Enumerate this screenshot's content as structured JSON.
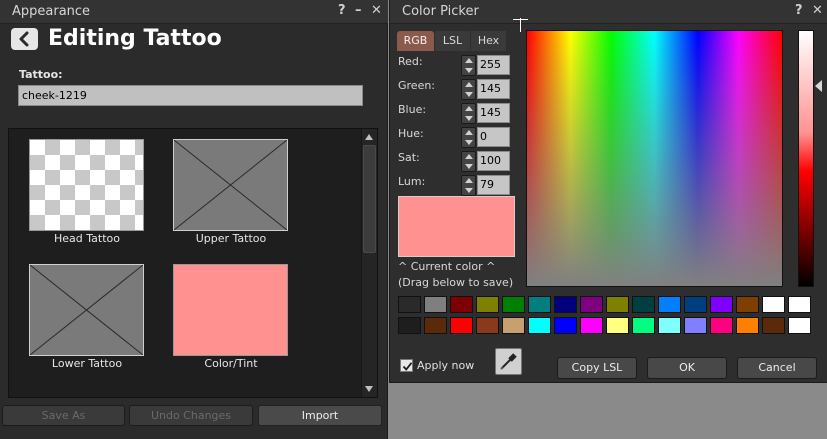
{
  "appearance": {
    "window_title": "Appearance",
    "help_label": "?",
    "minimize_label": "–",
    "close_label": "✕",
    "heading": "Editing Tattoo",
    "tattoo_label": "Tattoo:",
    "tattoo_value": "cheek-1219",
    "swatches": [
      {
        "label": "Head Tattoo"
      },
      {
        "label": "Upper Tattoo"
      },
      {
        "label": "Lower Tattoo"
      },
      {
        "label": "Color/Tint"
      }
    ],
    "buttons": {
      "save_as": "Save As",
      "undo_changes": "Undo Changes",
      "import": "Import"
    }
  },
  "color_picker": {
    "window_title": "Color Picker",
    "help_label": "?",
    "close_label": "✕",
    "tabs": [
      {
        "label": "RGB",
        "active": true
      },
      {
        "label": "LSL",
        "active": false
      },
      {
        "label": "Hex",
        "active": false
      }
    ],
    "fields": [
      {
        "label": "Red:",
        "value": "255"
      },
      {
        "label": "Green:",
        "value": "145"
      },
      {
        "label": "Blue:",
        "value": "145"
      },
      {
        "label": "Hue:",
        "value": "0"
      },
      {
        "label": "Sat:",
        "value": "100"
      },
      {
        "label": "Lum:",
        "value": "79"
      }
    ],
    "current_color": "#ff9191",
    "current_caption": "^ Current color ^",
    "drag_caption": "(Drag below to save)",
    "palette_row1": [
      "#2a2a2a",
      "#7f7f7f",
      "#7f0000",
      "#7f7f00",
      "#007f00",
      "#007f7f",
      "#00007f",
      "#7f007f",
      "#7f7f00",
      "#003f3f",
      "#007fff",
      "#003f7f",
      "#7f00ff",
      "#7f3f00",
      "#ffffff",
      "#ffffff"
    ],
    "palette_row2": [
      "#1e1e1e",
      "#5a2a0a",
      "#ff0000",
      "#8a3a1a",
      "#c8a070",
      "#00ffff",
      "#0000ff",
      "#ff00ff",
      "#ffff80",
      "#00ff80",
      "#80ffff",
      "#8080ff",
      "#ff0080",
      "#ff8000",
      "#5a2a0a",
      "#ffffff"
    ],
    "apply_now_label": "Apply now",
    "apply_now_checked": true,
    "buttons": {
      "copy_lsl": "Copy LSL",
      "ok": "OK",
      "cancel": "Cancel"
    }
  }
}
